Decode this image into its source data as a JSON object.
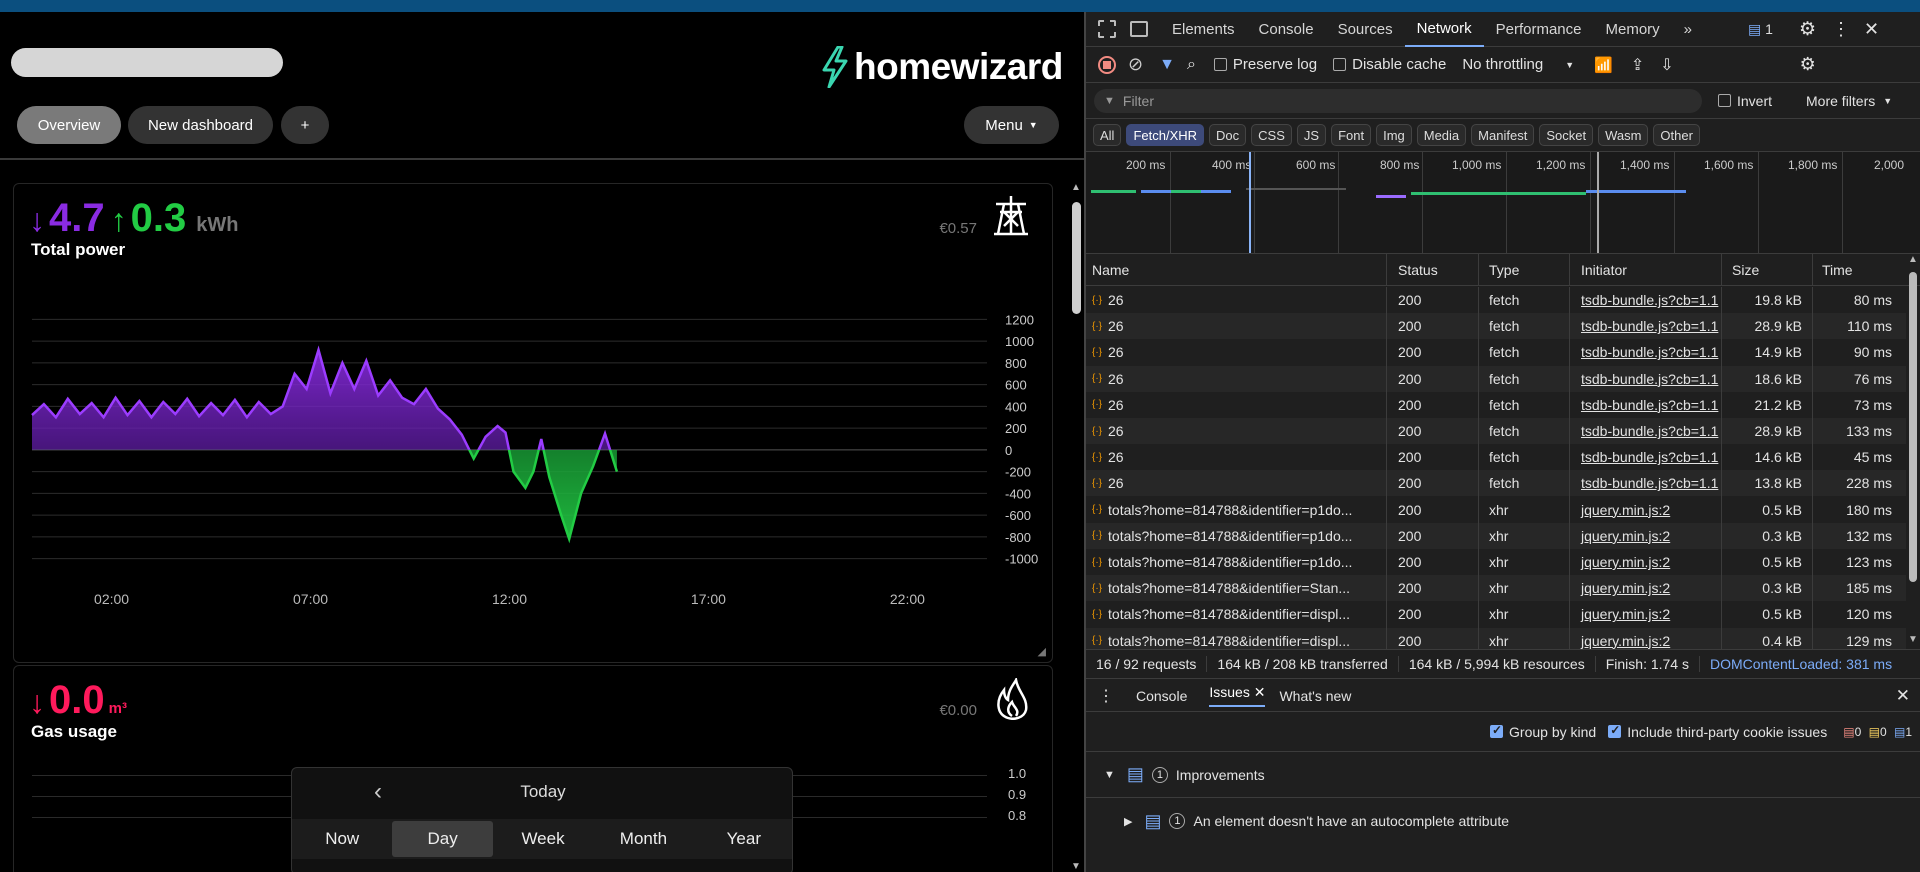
{
  "app": {
    "brand": "homewizard",
    "nav": {
      "overview": "Overview",
      "new_dashboard": "New dashboard",
      "plus": "+",
      "menu": "Menu"
    },
    "power_card": {
      "import_value": "4.7",
      "export_value": "0.3",
      "unit": "kWh",
      "title": "Total power",
      "cost": "€0.57",
      "colors": {
        "import": "#8a2be2",
        "export": "#22cc44"
      }
    },
    "gas_card": {
      "value": "0.0",
      "unit": "m³",
      "title": "Gas usage",
      "cost": "€0.00",
      "color": "#ff1a5c",
      "y_ticks": [
        "1.0",
        "0.9",
        "0.8"
      ]
    },
    "datebar": {
      "label": "Today",
      "prev": "‹",
      "periods": [
        "Now",
        "Day",
        "Week",
        "Month",
        "Year"
      ],
      "selected": "Day"
    }
  },
  "chart_data": {
    "type": "area",
    "y_ticks": [
      1200,
      1000,
      800,
      600,
      400,
      200,
      0,
      -200,
      -400,
      -600,
      -800,
      -1000
    ],
    "x_ticks": [
      "02:00",
      "07:00",
      "12:00",
      "17:00",
      "22:00"
    ],
    "ylim": [
      -1050,
      1250
    ],
    "xlim": [
      0,
      24
    ],
    "series": [
      {
        "values": [
          [
            0,
            320
          ],
          [
            0.3,
            420
          ],
          [
            0.6,
            300
          ],
          [
            0.9,
            470
          ],
          [
            1.2,
            330
          ],
          [
            1.5,
            430
          ],
          [
            1.8,
            300
          ],
          [
            2.1,
            480
          ],
          [
            2.4,
            320
          ],
          [
            2.7,
            450
          ],
          [
            3,
            300
          ],
          [
            3.3,
            440
          ],
          [
            3.6,
            330
          ],
          [
            3.9,
            470
          ],
          [
            4.2,
            310
          ],
          [
            4.5,
            430
          ],
          [
            4.8,
            320
          ],
          [
            5.1,
            460
          ],
          [
            5.4,
            300
          ],
          [
            5.7,
            440
          ],
          [
            6,
            330
          ],
          [
            6.3,
            400
          ],
          [
            6.6,
            700
          ],
          [
            6.9,
            560
          ],
          [
            7.2,
            920
          ],
          [
            7.5,
            520
          ],
          [
            7.8,
            800
          ],
          [
            8.1,
            560
          ],
          [
            8.4,
            820
          ],
          [
            8.7,
            500
          ],
          [
            9,
            640
          ],
          [
            9.3,
            480
          ],
          [
            9.6,
            420
          ],
          [
            9.9,
            560
          ],
          [
            10.2,
            380
          ],
          [
            10.5,
            280
          ],
          [
            10.8,
            140
          ],
          [
            11.1,
            -80
          ],
          [
            11.4,
            120
          ],
          [
            11.7,
            220
          ],
          [
            11.9,
            160
          ],
          [
            12.1,
            -200
          ],
          [
            12.4,
            -350
          ],
          [
            12.6,
            -200
          ],
          [
            12.8,
            100
          ],
          [
            13.0,
            -250
          ],
          [
            13.3,
            -600
          ],
          [
            13.5,
            -820
          ],
          [
            13.8,
            -400
          ],
          [
            14.1,
            -150
          ],
          [
            14.4,
            150
          ],
          [
            14.7,
            -200
          ]
        ]
      }
    ]
  },
  "devtools": {
    "tabs": [
      "Elements",
      "Console",
      "Sources",
      "Network",
      "Performance",
      "Memory",
      "»"
    ],
    "active_tab": "Network",
    "issues_count": "1",
    "toolbar": {
      "preserve_log": "Preserve log",
      "disable_cache": "Disable cache",
      "throttling": "No throttling"
    },
    "filter": {
      "placeholder": "Filter",
      "invert": "Invert",
      "more_filters": "More filters"
    },
    "types": [
      "All",
      "Fetch/XHR",
      "Doc",
      "CSS",
      "JS",
      "Font",
      "Img",
      "Media",
      "Manifest",
      "Socket",
      "Wasm",
      "Other"
    ],
    "active_type": "Fetch/XHR",
    "timeline_ticks": [
      "200 ms",
      "400 ms",
      "600 ms",
      "800 ms",
      "1,000 ms",
      "1,200 ms",
      "1,400 ms",
      "1,600 ms",
      "1,800 ms",
      "2,000"
    ],
    "columns": [
      "Name",
      "Status",
      "Type",
      "Initiator",
      "Size",
      "Time"
    ],
    "requests": [
      {
        "name": "26",
        "status": "200",
        "type": "fetch",
        "initiator": "tsdb-bundle.js?cb=1.1",
        "size": "19.8 kB",
        "time": "80 ms"
      },
      {
        "name": "26",
        "status": "200",
        "type": "fetch",
        "initiator": "tsdb-bundle.js?cb=1.1",
        "size": "28.9 kB",
        "time": "110 ms"
      },
      {
        "name": "26",
        "status": "200",
        "type": "fetch",
        "initiator": "tsdb-bundle.js?cb=1.1",
        "size": "14.9 kB",
        "time": "90 ms"
      },
      {
        "name": "26",
        "status": "200",
        "type": "fetch",
        "initiator": "tsdb-bundle.js?cb=1.1",
        "size": "18.6 kB",
        "time": "76 ms"
      },
      {
        "name": "26",
        "status": "200",
        "type": "fetch",
        "initiator": "tsdb-bundle.js?cb=1.1",
        "size": "21.2 kB",
        "time": "73 ms"
      },
      {
        "name": "26",
        "status": "200",
        "type": "fetch",
        "initiator": "tsdb-bundle.js?cb=1.1",
        "size": "28.9 kB",
        "time": "133 ms"
      },
      {
        "name": "26",
        "status": "200",
        "type": "fetch",
        "initiator": "tsdb-bundle.js?cb=1.1",
        "size": "14.6 kB",
        "time": "45 ms"
      },
      {
        "name": "26",
        "status": "200",
        "type": "fetch",
        "initiator": "tsdb-bundle.js?cb=1.1",
        "size": "13.8 kB",
        "time": "228 ms"
      },
      {
        "name": "totals?home=814788&identifier=p1do...",
        "status": "200",
        "type": "xhr",
        "initiator": "jquery.min.js:2",
        "size": "0.5 kB",
        "time": "180 ms"
      },
      {
        "name": "totals?home=814788&identifier=p1do...",
        "status": "200",
        "type": "xhr",
        "initiator": "jquery.min.js:2",
        "size": "0.3 kB",
        "time": "132 ms"
      },
      {
        "name": "totals?home=814788&identifier=p1do...",
        "status": "200",
        "type": "xhr",
        "initiator": "jquery.min.js:2",
        "size": "0.5 kB",
        "time": "123 ms"
      },
      {
        "name": "totals?home=814788&identifier=Stan...",
        "status": "200",
        "type": "xhr",
        "initiator": "jquery.min.js:2",
        "size": "0.3 kB",
        "time": "185 ms"
      },
      {
        "name": "totals?home=814788&identifier=displ...",
        "status": "200",
        "type": "xhr",
        "initiator": "jquery.min.js:2",
        "size": "0.5 kB",
        "time": "120 ms"
      },
      {
        "name": "totals?home=814788&identifier=displ...",
        "status": "200",
        "type": "xhr",
        "initiator": "jquery.min.js:2",
        "size": "0.4 kB",
        "time": "129 ms"
      }
    ],
    "status": {
      "requests": "16 / 92 requests",
      "transferred": "164 kB / 208 kB transferred",
      "resources": "164 kB / 5,994 kB resources",
      "finish": "Finish: 1.74 s",
      "dcl": "DOMContentLoaded: 381 ms"
    },
    "drawer": {
      "tabs": [
        "Console",
        "Issues",
        "What's new"
      ],
      "active": "Issues",
      "group_by_kind": "Group by kind",
      "third_party": "Include third-party cookie issues",
      "counts": {
        "errors": "0",
        "warnings": "0",
        "info": "1"
      },
      "group": {
        "label": "Improvements",
        "count": "1"
      },
      "issue": {
        "label": "An element doesn't have an autocomplete attribute",
        "count": "1"
      }
    }
  }
}
